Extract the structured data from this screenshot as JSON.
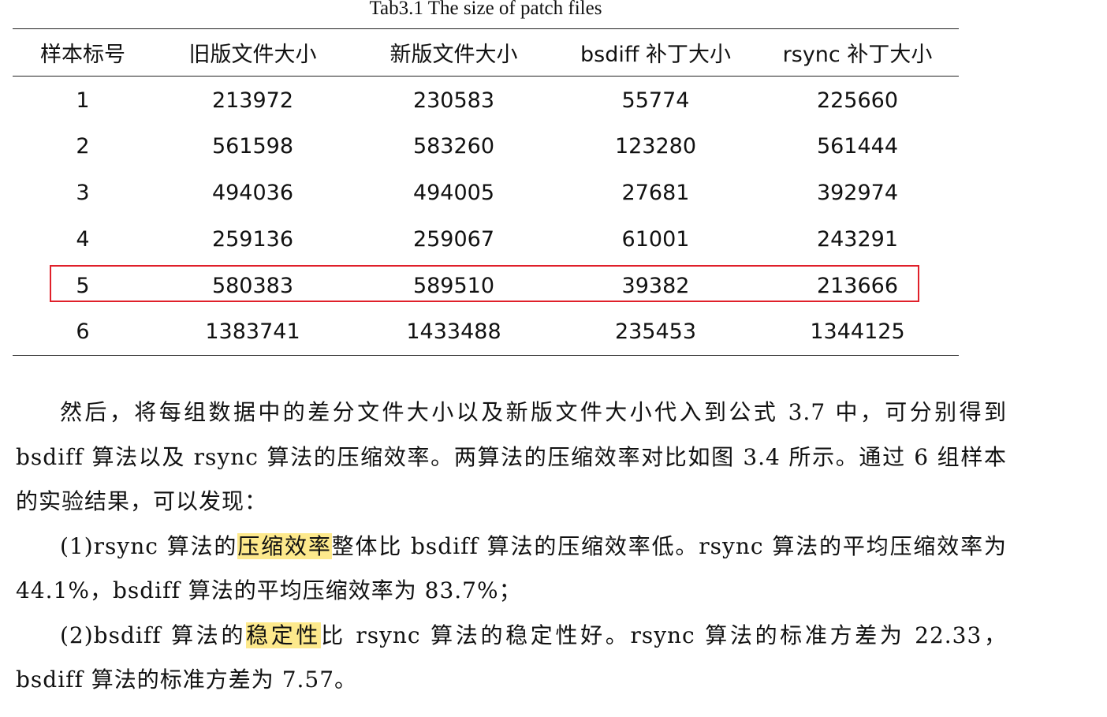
{
  "caption": "Tab3.1 The size of patch files",
  "table": {
    "headers": [
      "样本标号",
      "旧版文件大小",
      "新版文件大小",
      "bsdiff 补丁大小",
      "rsync 补丁大小"
    ],
    "rows": [
      [
        "1",
        "213972",
        "230583",
        "55774",
        "225660"
      ],
      [
        "2",
        "561598",
        "583260",
        "123280",
        "561444"
      ],
      [
        "3",
        "494036",
        "494005",
        "27681",
        "392974"
      ],
      [
        "4",
        "259136",
        "259067",
        "61001",
        "243291"
      ],
      [
        "5",
        "580383",
        "589510",
        "39382",
        "213666"
      ],
      [
        "6",
        "1383741",
        "1433488",
        "235453",
        "1344125"
      ]
    ],
    "highlighted_row": "5",
    "highlight_color": "#e0202a"
  },
  "paragraphs": {
    "p1": "然后，将每组数据中的差分文件大小以及新版文件大小代入到公式 3.7 中，可分别得到 bsdiff 算法以及 rsync 算法的压缩效率。两算法的压缩效率对比如图 3.4 所示。通过 6 组样本的实验结果，可以发现：",
    "p2_before": "(1)rsync 算法的",
    "p2_mark": "压缩效率",
    "p2_after": "整体比 bsdiff 算法的压缩效率低。rsync 算法的平均压缩效率为 44.1%，bsdiff 算法的平均压缩效率为 83.7%；",
    "p3_before": "(2)bsdiff 算法的",
    "p3_mark": "稳定性",
    "p3_after": "比 rsync 算法的稳定性好。rsync 算法的标准方差为 22.33，bsdiff 算法的标准方差为 7.57。",
    "mark_color": "#fde98c"
  }
}
